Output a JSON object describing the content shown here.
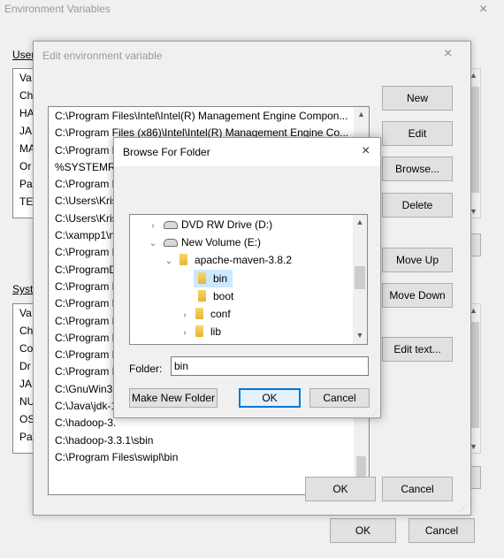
{
  "env_window": {
    "title": "Environment Variables",
    "close_glyph": "×",
    "user_group_label": "User",
    "system_group_label": "Syste",
    "user_list_initials": [
      "Va",
      "Ch",
      "HA",
      "JA",
      "MA",
      "Or",
      "Pa",
      "TE"
    ],
    "system_list_initials": [
      "Va",
      "Ch",
      "Co",
      "Dr",
      "JA",
      "NU",
      "OS",
      "Pa"
    ],
    "ok_label": "OK",
    "cancel_label": "Cancel"
  },
  "edit_dialog": {
    "title": "Edit environment variable",
    "close_glyph": "×",
    "entries": [
      "C:\\Program Files\\Intel\\Intel(R) Management Engine Compon...",
      "C:\\Program Files (x86)\\Intel\\Intel(R) Management Engine Co...",
      "C:\\Program Files\\Intel\\Intel(R) Management Engine Compon...",
      "%SYSTEMRO",
      "C:\\Program F",
      "C:\\Users\\Krish",
      "C:\\Users\\Krish",
      "C:\\xampp1\\n",
      "C:\\Program F",
      "C:\\ProgramD",
      "C:\\Program F",
      "C:\\Program F",
      "C:\\Program F",
      "C:\\Program F",
      "C:\\Program F",
      "C:\\Program F",
      "C:\\GnuWin32",
      "C:\\Java\\jdk-1",
      "C:\\hadoop-3.",
      "C:\\hadoop-3.3.1\\sbin",
      "C:\\Program Files\\swipl\\bin"
    ],
    "buttons": {
      "new": "New",
      "edit": "Edit",
      "browse": "Browse...",
      "delete": "Delete",
      "move_up": "Move Up",
      "move_down": "Move Down",
      "edit_text": "Edit text..."
    },
    "ok_label": "OK",
    "cancel_label": "Cancel"
  },
  "browse_dialog": {
    "title": "Browse For Folder",
    "close_glyph": "×",
    "tree": {
      "dvd": "DVD RW Drive (D:)",
      "volume_e": "New Volume (E:)",
      "maven": "apache-maven-3.8.2",
      "bin": "bin",
      "boot": "boot",
      "conf": "conf",
      "lib": "lib"
    },
    "expander_collapsed": "›",
    "expander_expanded": "⌄",
    "folder_label": "Folder:",
    "folder_value": "bin",
    "make_new_folder": "Make New Folder",
    "ok_label": "OK",
    "cancel_label": "Cancel",
    "selected_item": "bin"
  },
  "colors": {
    "accent": "#0078d7",
    "selection": "#cce8ff",
    "window_bg": "#f0f0f0"
  }
}
